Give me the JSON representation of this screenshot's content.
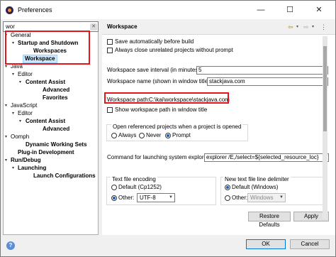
{
  "window": {
    "title": "Preferences",
    "minimize": "—",
    "maximize": "☐",
    "close": "✕"
  },
  "search": {
    "value": "wor"
  },
  "tree": [
    {
      "label": "General",
      "twisty": "▾"
    },
    {
      "label": "Startup and Shutdown",
      "twisty": "▾"
    },
    {
      "label": "Workspaces"
    },
    {
      "label": "Workspace"
    },
    {
      "label": "Java",
      "twisty": "▾"
    },
    {
      "label": "Editor",
      "twisty": "▾"
    },
    {
      "label": "Content Assist",
      "twisty": "▾"
    },
    {
      "label": "Advanced"
    },
    {
      "label": "Favorites"
    },
    {
      "label": "JavaScript",
      "twisty": "▾"
    },
    {
      "label": "Editor",
      "twisty": "▾"
    },
    {
      "label": "Content Assist",
      "twisty": "▾"
    },
    {
      "label": "Advanced"
    },
    {
      "label": "Oomph",
      "twisty": "▾"
    },
    {
      "label": "Dynamic Working Sets"
    },
    {
      "label": "Plug-in Development"
    },
    {
      "label": "Run/Debug",
      "twisty": "▾"
    },
    {
      "label": "Launching",
      "twisty": "▾"
    },
    {
      "label": "Launch Configurations"
    }
  ],
  "page": {
    "title": "Workspace",
    "nav": {
      "back": "⇦",
      "back_menu": "▾",
      "forward": "⇨",
      "forward_menu": "▾",
      "menu": "⋮"
    },
    "save_before_build": "Save automatically before build",
    "close_unrelated": "Always close unrelated projects without prompt",
    "save_interval_label": "Workspace save interval (in minutes):",
    "save_interval_value": "5",
    "workspace_name_label": "Workspace name (shown in window title):",
    "workspace_name_value": "stackjava.com",
    "workspace_path_label": "Workspace path:",
    "workspace_path_value": "C:\\kai\\workspace\\stackjava.com",
    "show_path_in_title": "Show workspace path in window title",
    "open_referenced_group": "Open referenced projects when a project is opened",
    "open_options": [
      "Always",
      "Never",
      "Prompt"
    ],
    "open_selected": "Prompt",
    "launch_cmd_label": "Command for launching system explorer:",
    "launch_cmd_value": "explorer /E,/select=${selected_resource_loc}",
    "text_encoding_group": "Text file encoding",
    "encoding_default": "Default (Cp1252)",
    "encoding_other": "Other:",
    "encoding_value": "UTF-8",
    "line_delim_group": "New text file line delimiter",
    "delim_default": "Default (Windows)",
    "delim_other": "Other:",
    "delim_value": "Windows",
    "restore_defaults": "Restore Defaults",
    "apply": "Apply"
  },
  "footer": {
    "help_icon": "?",
    "ok": "OK",
    "cancel": "Cancel"
  },
  "colors": {
    "highlight": "#e3161e",
    "selection": "#cce8ff"
  }
}
